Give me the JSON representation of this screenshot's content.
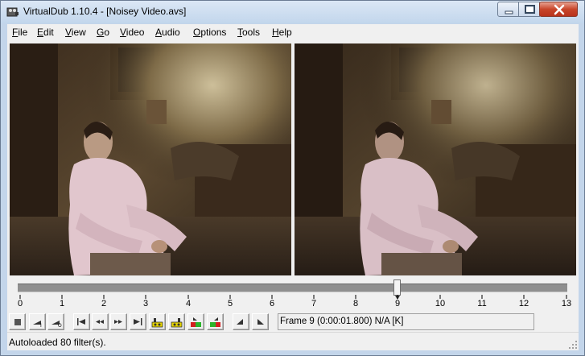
{
  "window": {
    "title": "VirtualDub 1.10.4 - [Noisey Video.avs]"
  },
  "menu": {
    "items": [
      "File",
      "Edit",
      "View",
      "Go",
      "Video",
      "Audio",
      "Options",
      "Tools",
      "Help"
    ]
  },
  "timeline": {
    "tick_labels": [
      "0",
      "1",
      "2",
      "3",
      "4",
      "5",
      "6",
      "7",
      "8",
      "9",
      "10",
      "11",
      "12",
      "13"
    ],
    "current_frame": 9,
    "total_frames": 13
  },
  "toolbar": {
    "buttons": [
      "stop-icon",
      "play-input-icon",
      "play-output-icon",
      "start-icon",
      "prev-frame-icon",
      "next-frame-icon",
      "end-icon",
      "prev-keyframe-icon",
      "next-keyframe-icon",
      "scene-back-icon",
      "scene-forward-icon",
      "mark-in-icon",
      "mark-out-icon"
    ],
    "frame_info": "Frame 9 (0:00:01.800) N/A [K]"
  },
  "status": {
    "text": "Autoloaded 80 filter(s)."
  },
  "colors": {
    "titlebar": "#c8d9ee",
    "close_button": "#c8452a",
    "client_bg": "#f0f0f0",
    "timeline_bar": "#8f8f8f"
  }
}
